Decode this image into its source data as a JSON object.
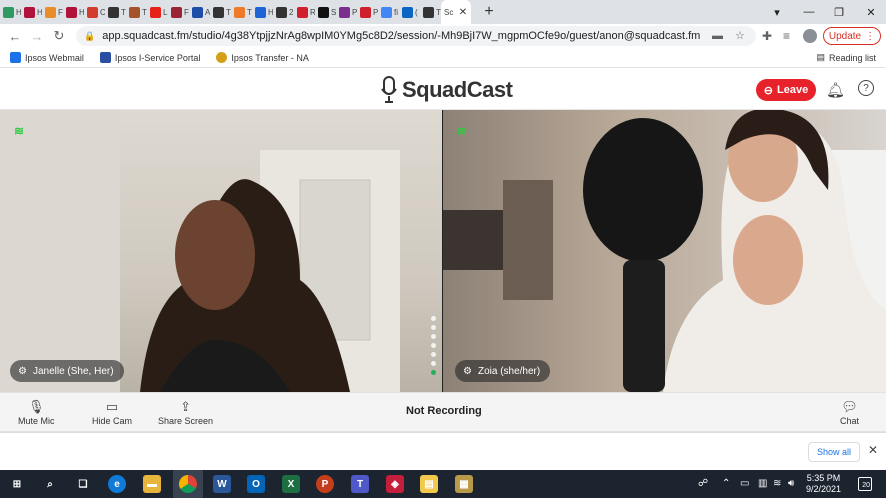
{
  "browser": {
    "tabs": [
      {
        "title": "H",
        "color": "#2e9a62"
      },
      {
        "title": "H",
        "color": "#b0123a"
      },
      {
        "title": "F",
        "color": "#e98c2a"
      },
      {
        "title": "H",
        "color": "#b0123a"
      },
      {
        "title": "C",
        "color": "#d33b2c"
      },
      {
        "title": "T",
        "color": "#333333"
      },
      {
        "title": "T",
        "color": "#a5512a"
      },
      {
        "title": "L",
        "color": "#e62117"
      },
      {
        "title": "F",
        "color": "#9a2436"
      },
      {
        "title": "A",
        "color": "#1f4ea8"
      },
      {
        "title": "T",
        "color": "#333333"
      },
      {
        "title": "T",
        "color": "#ef7b2a"
      },
      {
        "title": "H",
        "color": "#1f64d6"
      },
      {
        "title": "2",
        "color": "#333333"
      },
      {
        "title": "R",
        "color": "#d0202e"
      },
      {
        "title": "S",
        "color": "#111111"
      },
      {
        "title": "P",
        "color": "#7a2f8f"
      },
      {
        "title": "P",
        "color": "#d0202e"
      },
      {
        "title": "fi",
        "color": "#4285f4"
      },
      {
        "title": "(",
        "color": "#0a66c2"
      },
      {
        "title": "T",
        "color": "#333333"
      }
    ],
    "active_tab": {
      "title": "Sc",
      "close": "✕"
    },
    "new_tab": "+",
    "window": {
      "minimize": "—",
      "maximize": "❐",
      "close": "✕"
    },
    "url": "app.squadcast.fm/studio/4g38YtpjjzNrAg8wpIM0YMg5c8D2/session/-Mh9BjI7W_mgpmOCfe9o/guest/anon@squadcast.fm",
    "update_label": "Update",
    "bookmarks": [
      {
        "label": "Ipsos Webmail",
        "color": "#1a73e8"
      },
      {
        "label": "Ipsos I-Service Portal",
        "color": "#2b4fa0"
      },
      {
        "label": "Ipsos Transfer - NA",
        "color": "#d4a017"
      }
    ],
    "reading_list": "Reading list"
  },
  "app": {
    "brand": "SquadCast",
    "leave_label": "Leave",
    "participants": [
      {
        "name": "Janelle (She, Her)"
      },
      {
        "name": "Zoia (she/her)"
      }
    ],
    "controls": {
      "mute_mic": "Mute Mic",
      "hide_cam": "Hide Cam",
      "share_screen": "Share Screen",
      "status": "Not Recording",
      "chat": "Chat"
    }
  },
  "downloads": {
    "show_all": "Show all"
  },
  "taskbar": {
    "time": "5:35 PM",
    "date": "9/2/2021",
    "notifications": "20"
  }
}
